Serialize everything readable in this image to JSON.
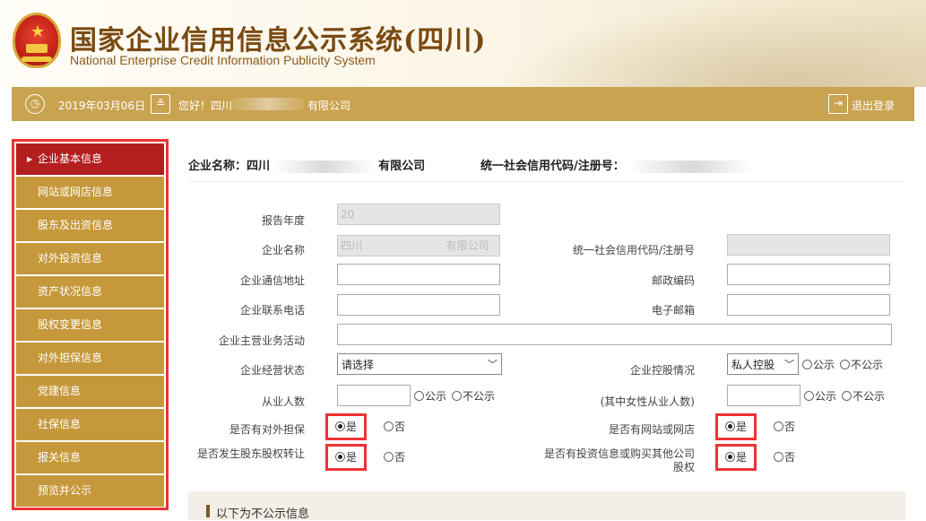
{
  "header": {
    "title_cn": "国家企业信用信息公示系统(四川)",
    "title_en": "National Enterprise Credit Information Publicity System"
  },
  "topbar": {
    "date": "2019年03月06日",
    "greeting": "您好！四川",
    "company_suffix": "有限公司",
    "logout": "退出登录"
  },
  "sidebar": {
    "items": [
      {
        "label": "企业基本信息",
        "active": true
      },
      {
        "label": "网站或网店信息"
      },
      {
        "label": "股东及出资信息"
      },
      {
        "label": "对外投资信息"
      },
      {
        "label": "资产状况信息"
      },
      {
        "label": "股权变更信息"
      },
      {
        "label": "对外担保信息"
      },
      {
        "label": "党建信息"
      },
      {
        "label": "社保信息"
      },
      {
        "label": "报关信息"
      },
      {
        "label": "预览并公示"
      }
    ]
  },
  "summary": {
    "company_label": "企业名称：四川",
    "company_suffix": "有限公司",
    "code_label": "统一社会信用代码/注册号："
  },
  "form": {
    "report_year_label": "报告年度",
    "report_year_value": "20",
    "company_name_label": "企业名称",
    "company_name_prefix": "四川",
    "company_name_suffix": "有限公司",
    "credit_code_label": "统一社会信用代码/注册号",
    "address_label": "企业通信地址",
    "postcode_label": "邮政编码",
    "phone_label": "企业联系电话",
    "email_label": "电子邮箱",
    "business_label": "企业主营业务活动",
    "status_label": "企业经营状态",
    "status_value": "请选择",
    "holding_label": "企业控股情况",
    "holding_value": "私人控股",
    "public_option": "公示",
    "nonpublic_option": "不公示",
    "employees_label": "从业人数",
    "female_label": "(其中女性从业人数)",
    "guarantee_label": "是否有对外担保",
    "website_label": "是否有网站或网店",
    "equity_transfer_label": "是否发生股东股权转让",
    "investment_label": "是否有投资信息或购买其他公司股权",
    "yes": "是",
    "no": "否"
  },
  "bottom": {
    "title": "以下为不公示信息"
  }
}
